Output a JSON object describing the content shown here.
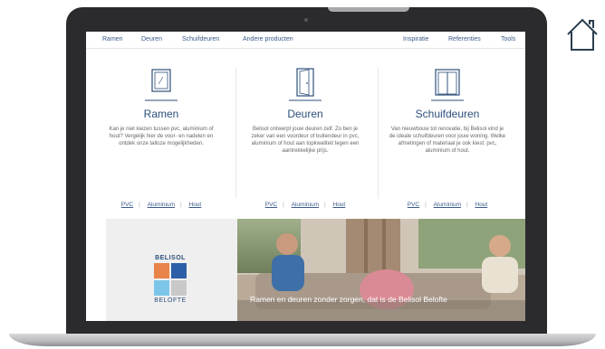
{
  "nav": {
    "left": [
      "Ramen",
      "Deuren",
      "Schuifdeuren",
      "Andere producten"
    ],
    "right": [
      "Inspiratie",
      "Referenties",
      "Tools"
    ]
  },
  "columns": [
    {
      "icon": "window-icon",
      "title": "Ramen",
      "text": "Kan je niet kiezen tussen pvc, aluminium of hout? Vergelijk hier de voor- en nadelen en ontdek onze talloze mogelijkheden.",
      "links": [
        "PVC",
        "Aluminium",
        "Hout"
      ]
    },
    {
      "icon": "door-icon",
      "title": "Deuren",
      "text": "Belisol ontwerpt jouw deuren zelf. Zo ben je zeker van een voordeur of buitendeur in pvc, aluminium of hout aan topkwaliteit tegen een aantrekkelijke prijs.",
      "links": [
        "PVC",
        "Aluminium",
        "Hout"
      ]
    },
    {
      "icon": "sliding-door-icon",
      "title": "Schuifdeuren",
      "text": "Van nieuwbouw tot renovatie, bij Belisol vind je de ideale schuifdeuren voor jouw woning. Welke afmetingen of materiaal je ook kiest: pvc, aluminium of hout.",
      "links": [
        "PVC",
        "Aluminium",
        "Hout"
      ]
    }
  ],
  "promo": {
    "logo_top": "BELISOL",
    "logo_bottom": "BELOFTE",
    "logo_colors": [
      "#e8834a",
      "#2c5fa8",
      "#7cc6ea",
      "#c9c9c9"
    ],
    "caption": "Ramen en deuren zonder zorgen, dat is de Belisol Belofte"
  }
}
